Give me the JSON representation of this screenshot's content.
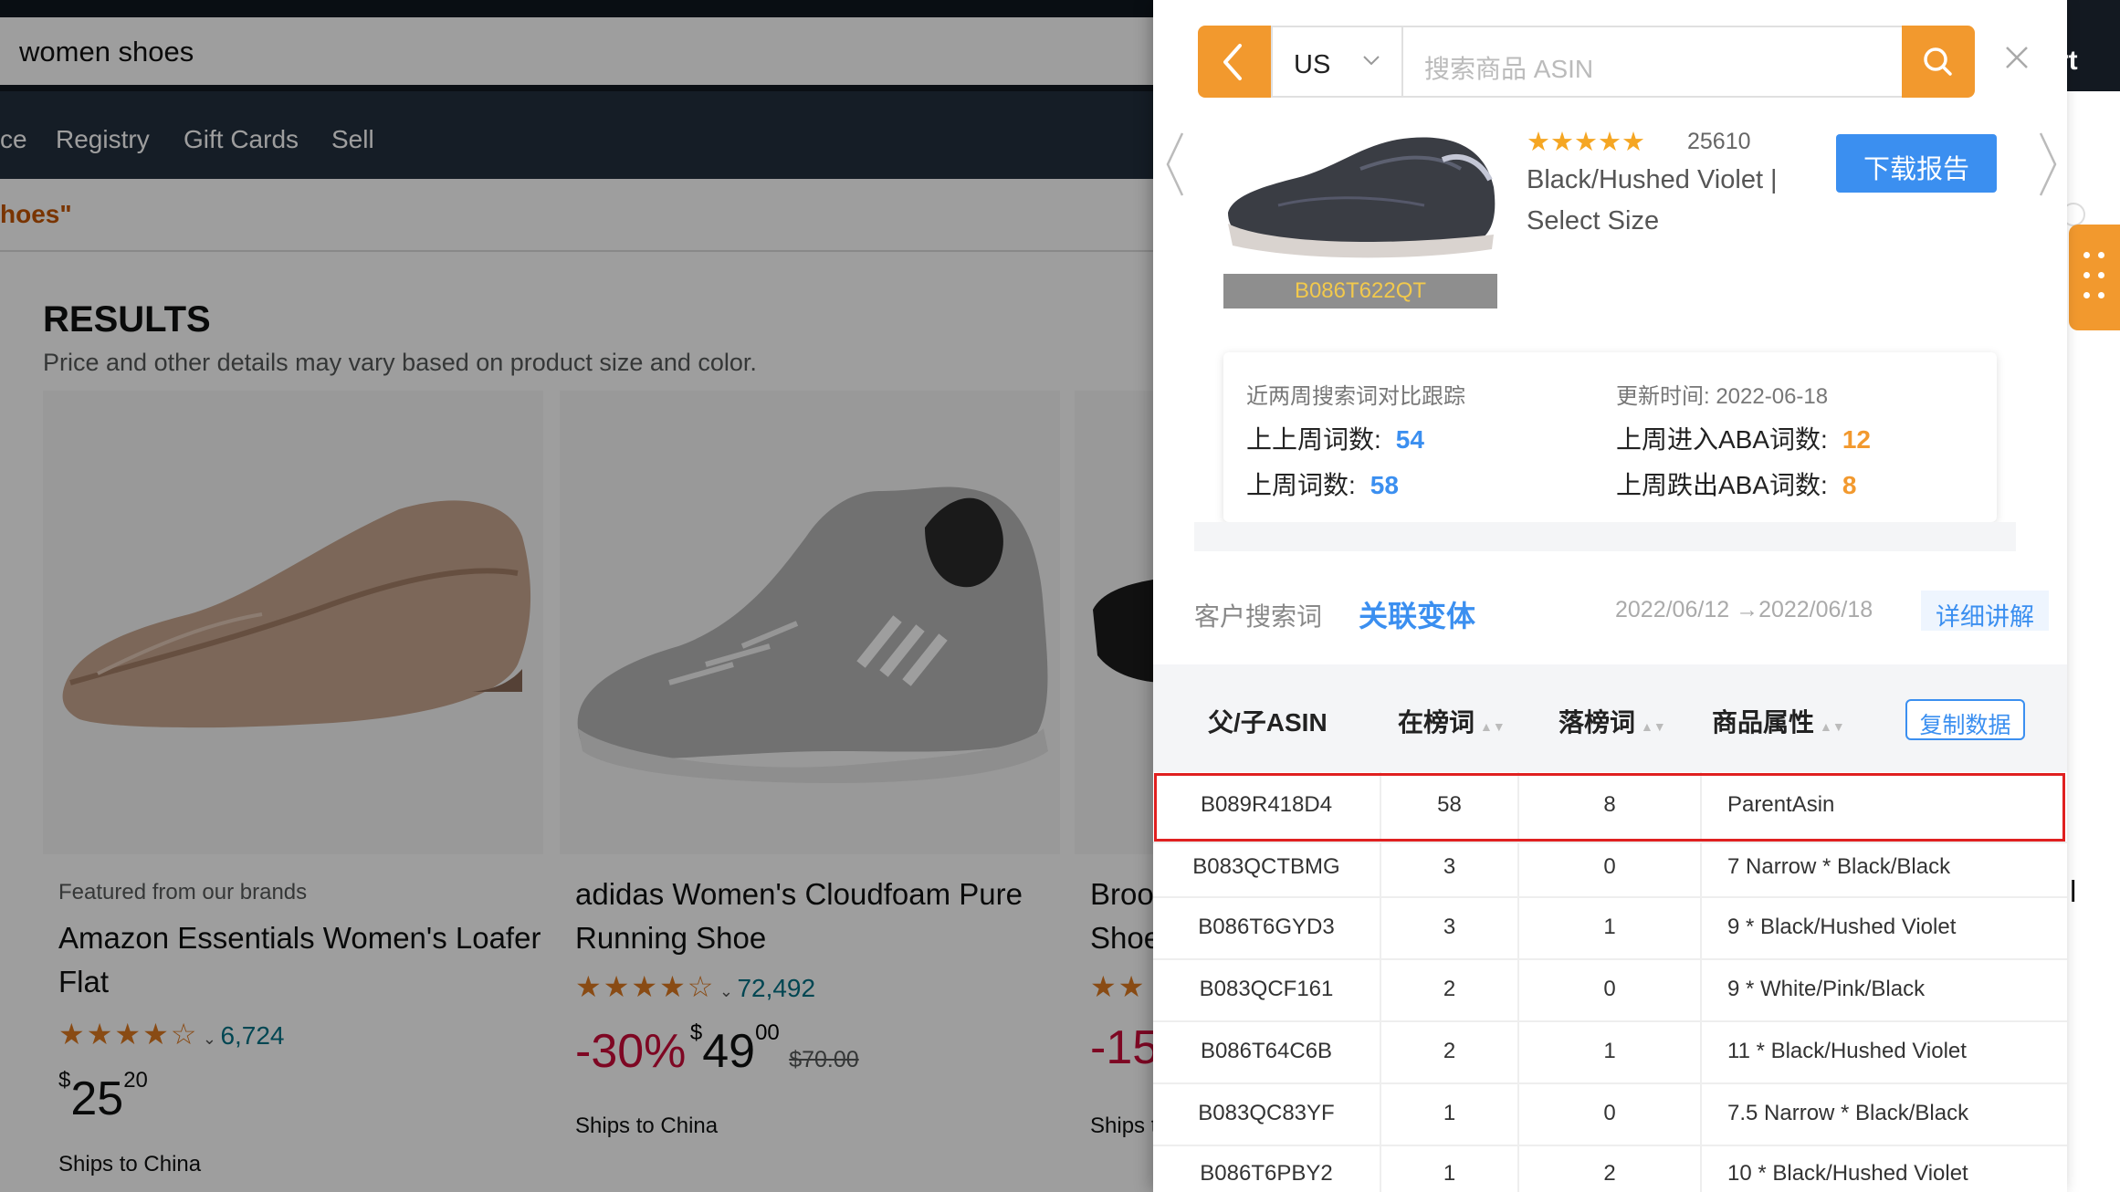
{
  "amazon": {
    "search_value": "women shoes",
    "nav_items": [
      "ce",
      "Registry",
      "Gift Cards",
      "Sell"
    ],
    "breadcrumb": "hoes\"",
    "results_title": "RESULTS",
    "results_sub": "Price and other details may vary based on product size and color.",
    "cart_label": "rt",
    "products": [
      {
        "brand": "Featured from our brands",
        "title_line1": "Amazon Essentials Women's Loafer",
        "title_line2": "Flat",
        "stars": "★★★★☆",
        "rating_fraction": 0.8,
        "reviews": "6,724",
        "price_symbol": "$",
        "price_whole": "25",
        "price_cents": "20",
        "shipping": "Ships to China"
      },
      {
        "title_line1": "adidas Women's Cloudfoam Pure",
        "title_line2": "Running Shoe",
        "stars": "★★★★☆",
        "rating_fraction": 0.9,
        "reviews": "72,492",
        "discount": "-30%",
        "price_symbol": "$",
        "price_whole": "49",
        "price_cents": "00",
        "list_price": "$70.00",
        "shipping": "Ships to China"
      },
      {
        "title_line1": "Broo",
        "title_line2": "Shoe",
        "stars": "★★",
        "discount": "-15",
        "shipping": "Ships t"
      }
    ],
    "right_fragment": "l"
  },
  "panel": {
    "marketplace": "US",
    "search_placeholder": "搜索商品 ASIN",
    "product": {
      "stars": "★★★★★",
      "rating_fraction": 0.9,
      "review_count": "25610",
      "name_line1": "Black/Hushed Violet |",
      "name_line2": "Select Size",
      "asin": "B086T622QT",
      "download_label": "下载报告"
    },
    "stats": {
      "caption": "近两周搜索词对比跟踪",
      "updated": "更新时间: 2022-06-18",
      "prev_prev_week_label": "上上周词数:",
      "prev_prev_week_value": "54",
      "last_week_label": "上周词数:",
      "last_week_value": "58",
      "entered_aba_label": "上周进入ABA词数:",
      "entered_aba_value": "12",
      "dropped_aba_label": "上周跌出ABA词数:",
      "dropped_aba_value": "8"
    },
    "tabs": {
      "customer_search": "客户搜索词",
      "related_variants": "关联变体",
      "date_range": "2022/06/12 →2022/06/18",
      "explain": "详细讲解"
    },
    "table": {
      "headers": [
        "父/子ASIN",
        "在榜词",
        "落榜词",
        "商品属性"
      ],
      "copy_label": "复制数据",
      "rows": [
        {
          "asin": "B089R418D4",
          "ranked": "58",
          "dropped": "8",
          "attr": "ParentAsin"
        },
        {
          "asin": "B083QCTBMG",
          "ranked": "3",
          "dropped": "0",
          "attr": "7 Narrow * Black/Black"
        },
        {
          "asin": "B086T6GYD3",
          "ranked": "3",
          "dropped": "1",
          "attr": "9 * Black/Hushed Violet"
        },
        {
          "asin": "B083QCF161",
          "ranked": "2",
          "dropped": "0",
          "attr": "9 * White/Pink/Black"
        },
        {
          "asin": "B086T64C6B",
          "ranked": "2",
          "dropped": "1",
          "attr": "11 * Black/Hushed Violet"
        },
        {
          "asin": "B083QC83YF",
          "ranked": "1",
          "dropped": "0",
          "attr": "7.5 Narrow * Black/Black"
        },
        {
          "asin": "B086T6PBY2",
          "ranked": "1",
          "dropped": "2",
          "attr": "10 * Black/Hushed Violet"
        }
      ]
    }
  },
  "colors": {
    "accent_orange": "#f2992e",
    "accent_blue": "#3b8ff0",
    "highlight_red": "#e02020",
    "amazon_dark": "#131921"
  }
}
